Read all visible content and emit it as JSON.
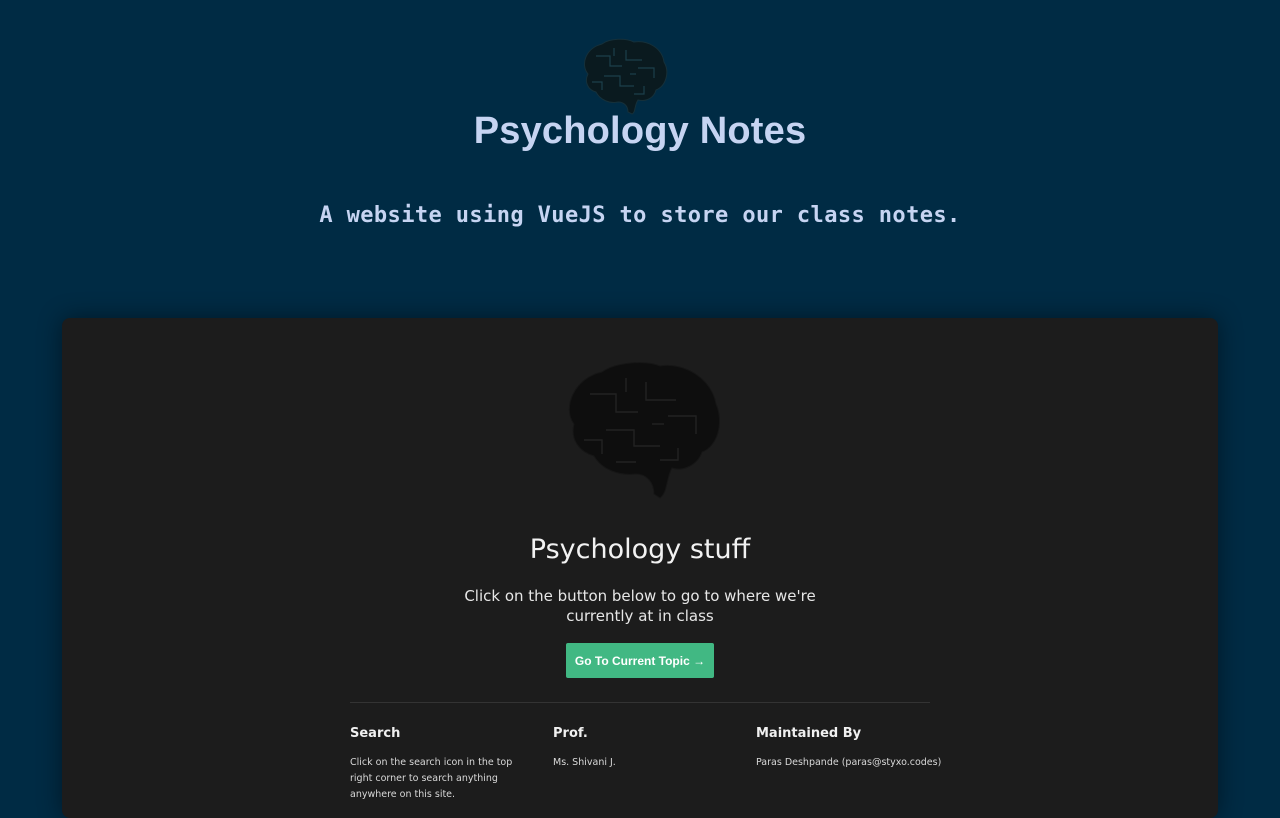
{
  "header": {
    "logo_icon": "brain-icon",
    "title": "Psychology Notes",
    "tagline": "A website using VueJS to store our class notes."
  },
  "card": {
    "logo_icon": "brain-icon",
    "title": "Psychology stuff",
    "description": "Click on the button below to go to where we're currently at in class",
    "button_label": "Go To Current Topic →"
  },
  "footer": {
    "columns": [
      {
        "heading": "Search",
        "text": "Click on the search icon in the top right corner to search anything anywhere on this site."
      },
      {
        "heading": "Prof.",
        "text": "Ms. Shivani J."
      },
      {
        "heading": "Maintained By",
        "text": "Paras Deshpande (paras@styxo.codes)"
      }
    ]
  },
  "colors": {
    "page_background": "#002b44",
    "title_color": "#c6d4f2",
    "card_background": "#1c1c1c",
    "button_accent": "#41b883"
  }
}
